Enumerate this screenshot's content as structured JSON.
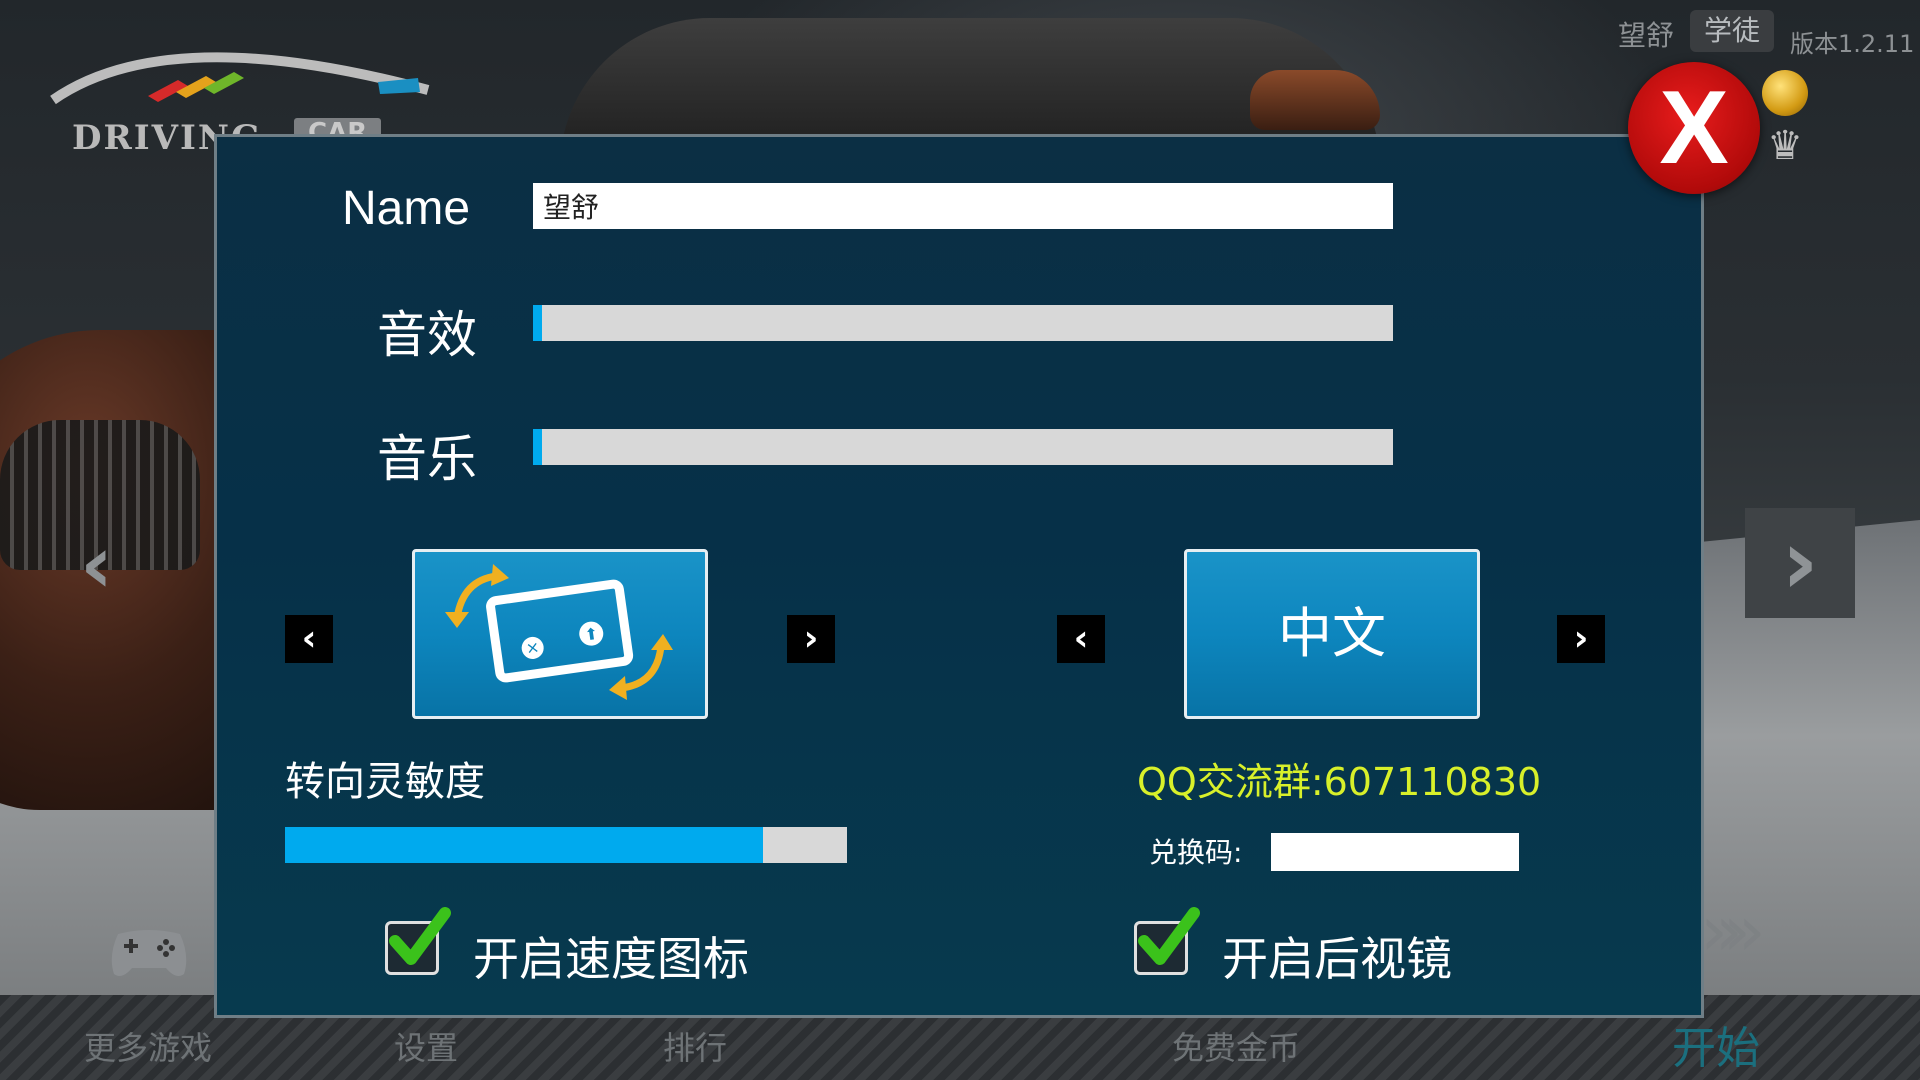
{
  "logo": {
    "text": "DRIVING",
    "tag": "CAR"
  },
  "profile": {
    "name": "望舒",
    "rank": "学徒",
    "version": "版本1.2.11"
  },
  "settings": {
    "name_label": "Name",
    "name_value": "望舒",
    "sfx_label": "音效",
    "sfx_level": 0.01,
    "music_label": "音乐",
    "music_level": 0.01,
    "language_value": "中文",
    "steering_label": "转向灵敏度",
    "steering_level": 0.85,
    "qq_group": "QQ交流群:607110830",
    "redeem_label": "兑换码:",
    "redeem_value": "",
    "speedometer_label": "开启速度图标",
    "speedometer_checked": true,
    "rear_mirror_label": "开启后视镜",
    "rear_mirror_checked": true
  },
  "bottom_menu": {
    "more_games": "更多游戏",
    "settings": "设置",
    "leaderboard": "排行",
    "free_coins": "免费金币",
    "start": "开始"
  },
  "icons": {
    "close": "close-icon",
    "prev": "chevron-left-icon",
    "next": "chevron-right-icon",
    "rotate_device": "rotate-device-icon",
    "checkbox": "checkmark-icon",
    "coin": "coin-icon",
    "crown": "crown-icon",
    "gamepad": "gamepad-icon"
  },
  "colors": {
    "dialog_bg": "#063048",
    "slider_fill": "#00aaee",
    "tile_blue": "#0d86be",
    "qq_text": "#d8f02a",
    "close_red": "#d01414",
    "check_green": "#3bc21b"
  }
}
